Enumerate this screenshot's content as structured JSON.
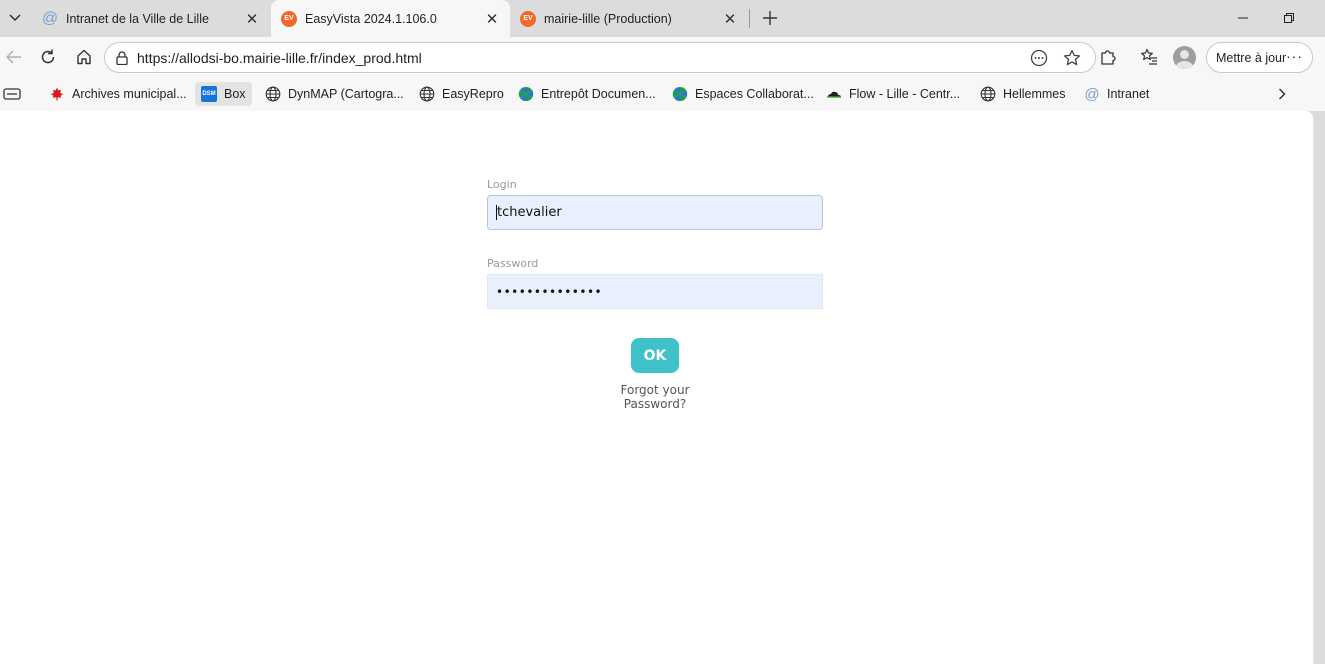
{
  "browser": {
    "tabs": [
      {
        "title": "Intranet de la Ville de Lille",
        "favicon": "at-icon",
        "active": false
      },
      {
        "title": "EasyVista 2024.1.106.0",
        "favicon": "EV",
        "active": true
      },
      {
        "title": "mairie-lille (Production)",
        "favicon": "EV",
        "active": false
      }
    ],
    "address": {
      "url": "https://allodsi-bo.mairie-lille.fr/index_prod.html"
    },
    "update_button": {
      "label": "Mettre à jour",
      "more": "···"
    }
  },
  "bookmarks": [
    {
      "label": "Archives municipal...",
      "icon": "maple-leaf-icon"
    },
    {
      "label": "Box",
      "icon": "dsm-icon",
      "badge": "DSM"
    },
    {
      "label": "DynMAP (Cartogra...",
      "icon": "globe-icon"
    },
    {
      "label": "EasyRepro",
      "icon": "globe-icon"
    },
    {
      "label": "Entrepôt Documen...",
      "icon": "pinwheel-icon"
    },
    {
      "label": "Espaces Collaborat...",
      "icon": "pinwheel-icon"
    },
    {
      "label": "Flow - Lille - Centr...",
      "icon": "cloud-icon"
    },
    {
      "label": "Hellemmes",
      "icon": "globe-icon"
    },
    {
      "label": "Intranet",
      "icon": "at-icon"
    }
  ],
  "login_form": {
    "login_label": "Login",
    "login_value": "tchevalier",
    "password_label": "Password",
    "password_value": "••••••••••••••",
    "ok_label": "OK",
    "forgot_label": "Forgot your Password?"
  },
  "colors": {
    "accent": "#3fc1c9",
    "easyvista_brand": "#f2682a",
    "autofill_bg": "#e8f0fe"
  }
}
